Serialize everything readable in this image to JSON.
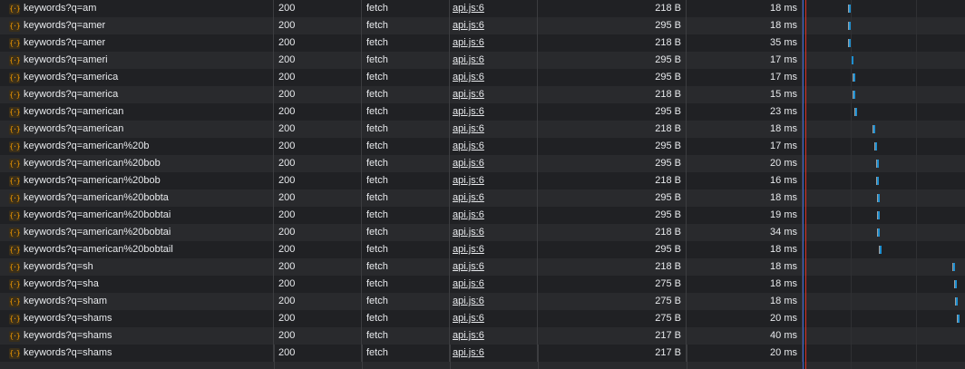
{
  "requests": [
    {
      "name": "keywords?q=am",
      "status": "200",
      "type": "fetch",
      "initiator": "api.js:6",
      "size": "218 B",
      "time": "18 ms",
      "wf_start": 0.19
    },
    {
      "name": "keywords?q=amer",
      "status": "200",
      "type": "fetch",
      "initiator": "api.js:6",
      "size": "295 B",
      "time": "18 ms",
      "wf_start": 0.19
    },
    {
      "name": "keywords?q=amer",
      "status": "200",
      "type": "fetch",
      "initiator": "api.js:6",
      "size": "218 B",
      "time": "35 ms",
      "wf_start": 0.19
    },
    {
      "name": "keywords?q=ameri",
      "status": "200",
      "type": "fetch",
      "initiator": "api.js:6",
      "size": "295 B",
      "time": "17 ms",
      "wf_start": 0.21
    },
    {
      "name": "keywords?q=america",
      "status": "200",
      "type": "fetch",
      "initiator": "api.js:6",
      "size": "295 B",
      "time": "17 ms",
      "wf_start": 0.22
    },
    {
      "name": "keywords?q=america",
      "status": "200",
      "type": "fetch",
      "initiator": "api.js:6",
      "size": "218 B",
      "time": "15 ms",
      "wf_start": 0.22
    },
    {
      "name": "keywords?q=american",
      "status": "200",
      "type": "fetch",
      "initiator": "api.js:6",
      "size": "295 B",
      "time": "23 ms",
      "wf_start": 0.23
    },
    {
      "name": "keywords?q=american",
      "status": "200",
      "type": "fetch",
      "initiator": "api.js:6",
      "size": "218 B",
      "time": "18 ms",
      "wf_start": 0.35
    },
    {
      "name": "keywords?q=american%20b",
      "status": "200",
      "type": "fetch",
      "initiator": "api.js:6",
      "size": "295 B",
      "time": "17 ms",
      "wf_start": 0.36
    },
    {
      "name": "keywords?q=american%20bob",
      "status": "200",
      "type": "fetch",
      "initiator": "api.js:6",
      "size": "295 B",
      "time": "20 ms",
      "wf_start": 0.37
    },
    {
      "name": "keywords?q=american%20bob",
      "status": "200",
      "type": "fetch",
      "initiator": "api.js:6",
      "size": "218 B",
      "time": "16 ms",
      "wf_start": 0.37
    },
    {
      "name": "keywords?q=american%20bobta",
      "status": "200",
      "type": "fetch",
      "initiator": "api.js:6",
      "size": "295 B",
      "time": "18 ms",
      "wf_start": 0.38
    },
    {
      "name": "keywords?q=american%20bobtai",
      "status": "200",
      "type": "fetch",
      "initiator": "api.js:6",
      "size": "295 B",
      "time": "19 ms",
      "wf_start": 0.38
    },
    {
      "name": "keywords?q=american%20bobtai",
      "status": "200",
      "type": "fetch",
      "initiator": "api.js:6",
      "size": "218 B",
      "time": "34 ms",
      "wf_start": 0.38
    },
    {
      "name": "keywords?q=american%20bobtail",
      "status": "200",
      "type": "fetch",
      "initiator": "api.js:6",
      "size": "295 B",
      "time": "18 ms",
      "wf_start": 0.39
    },
    {
      "name": "keywords?q=sh",
      "status": "200",
      "type": "fetch",
      "initiator": "api.js:6",
      "size": "218 B",
      "time": "18 ms",
      "wf_start": 0.87
    },
    {
      "name": "keywords?q=sha",
      "status": "200",
      "type": "fetch",
      "initiator": "api.js:6",
      "size": "275 B",
      "time": "18 ms",
      "wf_start": 0.88
    },
    {
      "name": "keywords?q=sham",
      "status": "200",
      "type": "fetch",
      "initiator": "api.js:6",
      "size": "275 B",
      "time": "18 ms",
      "wf_start": 0.89
    },
    {
      "name": "keywords?q=shams",
      "status": "200",
      "type": "fetch",
      "initiator": "api.js:6",
      "size": "275 B",
      "time": "20 ms",
      "wf_start": 0.9
    },
    {
      "name": "keywords?q=shams",
      "status": "200",
      "type": "fetch",
      "initiator": "api.js:6",
      "size": "217 B",
      "time": "40 ms",
      "wf_start": null
    },
    {
      "name": "keywords?q=shams",
      "status": "200",
      "type": "fetch",
      "initiator": "api.js:6",
      "size": "217 B",
      "time": "20 ms",
      "wf_start": null
    }
  ],
  "icons": {
    "request": "fetch-braces-icon",
    "request_glyph": "{·}"
  },
  "colors": {
    "waiting": "#a0a0a0",
    "receiving": "#1e8fd0",
    "dom_content_loaded": "#3b66d8",
    "load": "#d93025"
  }
}
